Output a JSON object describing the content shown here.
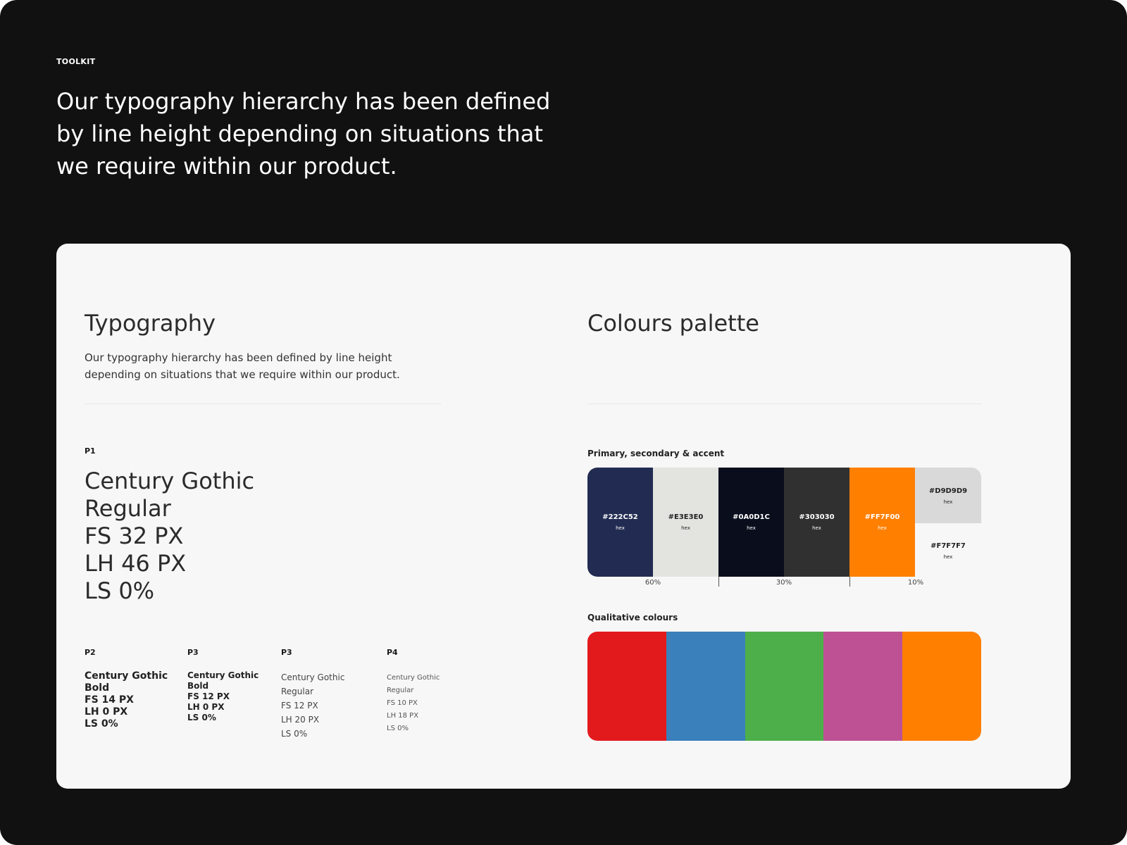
{
  "header": {
    "eyebrow": "TOOLKIT",
    "headline": "Our typography hierarchy has been defined by line height depending on situations that we require within our product."
  },
  "typography": {
    "title": "Typography",
    "description": "Our typography hierarchy has been defined by line height depending on situations that we require within our product.",
    "p1": {
      "label": "P1",
      "lines": [
        "Century Gothic",
        "Regular",
        "FS 32 PX",
        "LH 46 PX",
        "LS 0%"
      ]
    },
    "styles": [
      {
        "label": "P2",
        "lines": [
          "Century Gothic",
          "Bold",
          "FS 14 PX",
          "LH 0 PX",
          "LS 0%"
        ]
      },
      {
        "label": "P3",
        "lines": [
          "Century Gothic",
          "Bold",
          "FS 12 PX",
          "LH 0 PX",
          "LS 0%"
        ]
      },
      {
        "label": "P3",
        "lines": [
          "Century Gothic",
          "Regular",
          "FS 12 PX",
          "LH 20 PX",
          "LS 0%"
        ]
      },
      {
        "label": "P4",
        "lines": [
          "Century Gothic",
          "Regular",
          "FS 10 PX",
          "LH 18 PX",
          "LS 0%"
        ]
      }
    ]
  },
  "colours": {
    "title": "Colours palette",
    "primary_heading": "Primary, secondary & accent",
    "palette": [
      {
        "hex": "#222C52",
        "label": "hex",
        "color": "#222c52",
        "text_color": "#ffffff"
      },
      {
        "hex": "#E3E3E0",
        "label": "hex",
        "color": "#e3e3e0",
        "text_color": "#222222"
      },
      {
        "hex": "#0A0D1C",
        "label": "hex",
        "color": "#0a0d1c",
        "text_color": "#ffffff"
      },
      {
        "hex": "#303030",
        "label": "hex",
        "color": "#303030",
        "text_color": "#ffffff"
      },
      {
        "hex": "#FF7F00",
        "label": "hex",
        "color": "#ff7f00",
        "text_color": "#ffffff"
      },
      {
        "hex": "#D9D9D9",
        "label": "hex",
        "color": "#d9d9d9",
        "text_color": "#222222"
      },
      {
        "hex": "#F7F7F7",
        "label": "hex",
        "color": "#f7f7f7",
        "text_color": "#222222"
      }
    ],
    "ratios": [
      "60%",
      "30%",
      "10%"
    ],
    "qualitative_heading": "Qualitative colours",
    "qualitative": [
      "#e31a1c",
      "#3a80bb",
      "#4daf4a",
      "#bd5193",
      "#ff7f00"
    ]
  }
}
